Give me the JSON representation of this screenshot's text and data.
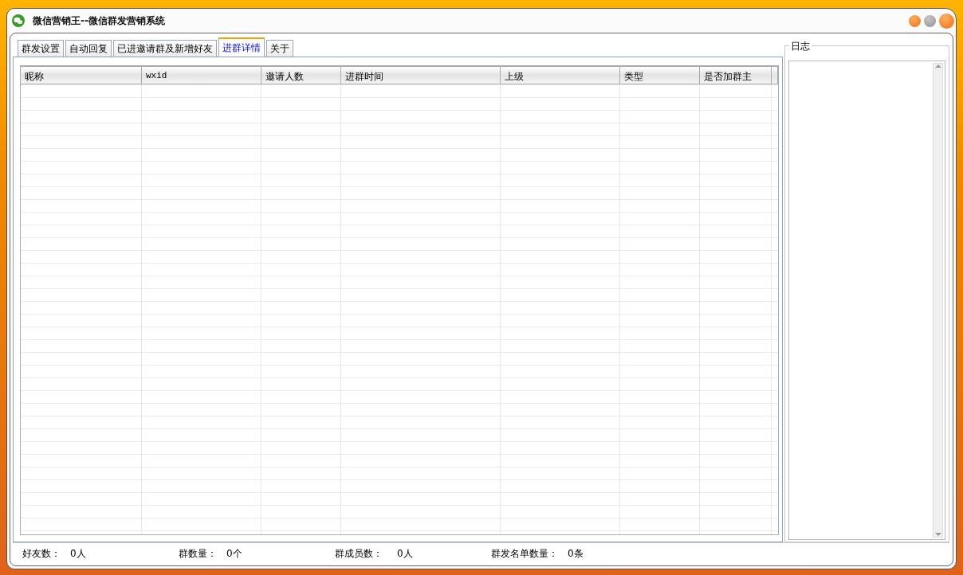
{
  "window": {
    "title": "微信营销王--微信群发营销系统"
  },
  "tabs": [
    {
      "label": "群发设置",
      "selected": false
    },
    {
      "label": "自动回复",
      "selected": false
    },
    {
      "label": "已进邀请群及新增好友",
      "selected": false
    },
    {
      "label": "进群详情",
      "selected": true
    },
    {
      "label": "关于",
      "selected": false
    }
  ],
  "table": {
    "columns": [
      "昵称",
      "wxid",
      "邀请人数",
      "进群时间",
      "上级",
      "类型",
      "是否加群主"
    ]
  },
  "log": {
    "title": "日志"
  },
  "status_bar": [
    {
      "label": "好友数：",
      "value": "0人"
    },
    {
      "label": "群数量：",
      "value": "0个"
    },
    {
      "label": "群成员数：",
      "value": "0人"
    },
    {
      "label": "群发名单数量：",
      "value": "0条"
    }
  ]
}
